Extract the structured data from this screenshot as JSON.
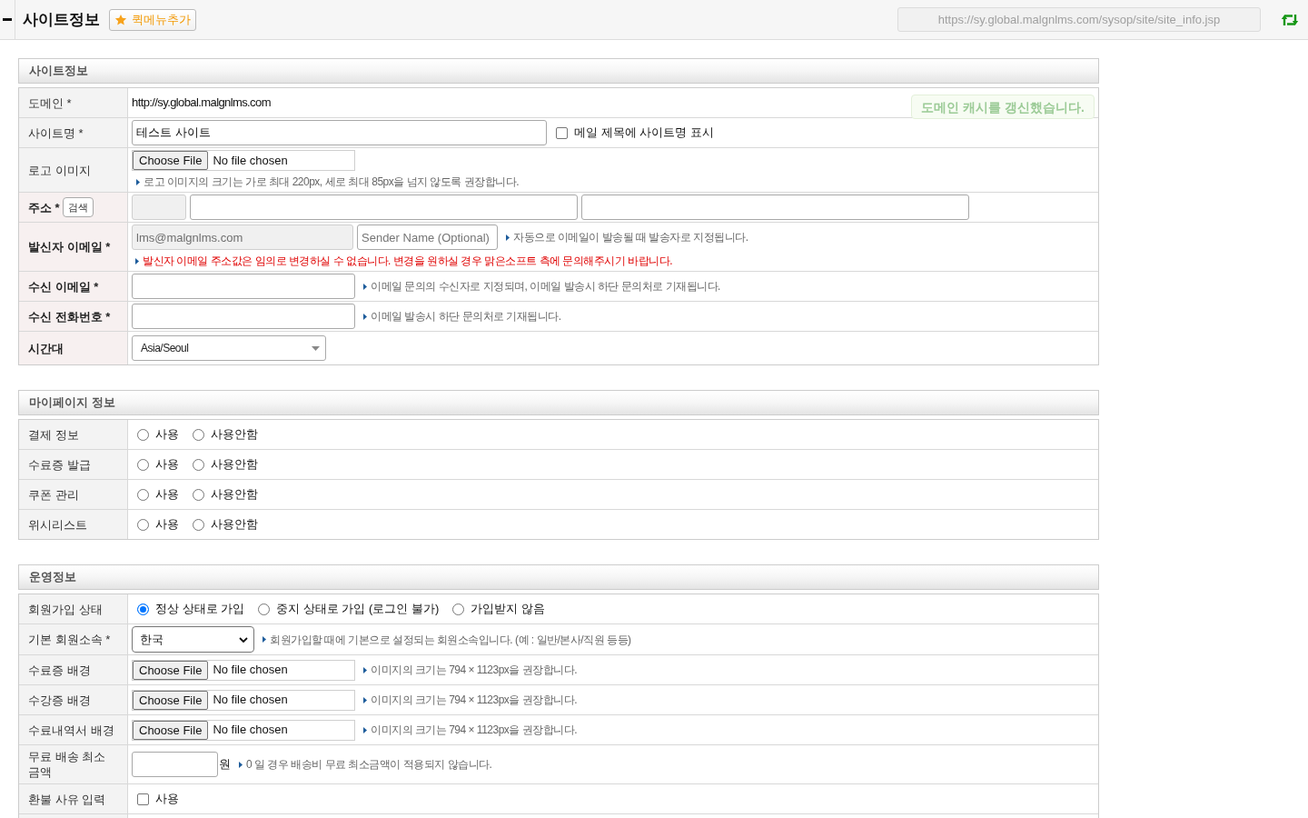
{
  "header": {
    "title": "사이트정보",
    "quick_menu_button": "퀵메뉴추가",
    "url": "https://sy.global.malgnlms.com/sysop/site/site_info.jsp"
  },
  "toast": "도메인 캐시를 갱신했습니다.",
  "sections": [
    {
      "title": "사이트정보",
      "rows": [
        {
          "label": "도메인 *",
          "emphasized": false,
          "lines": [
            [
              {
                "kind": "text",
                "text": "http://sy.global.malgnlms.com"
              }
            ]
          ]
        },
        {
          "label": "사이트명 *",
          "emphasized": false,
          "lines": [
            [
              {
                "kind": "input",
                "value": "테스트 사이트",
                "disabled": false
              },
              {
                "kind": "checkbox",
                "label": "메일 제목에 사이트명 표시",
                "checked": false
              }
            ]
          ]
        },
        {
          "label": "로고 이미지",
          "emphasized": false,
          "lines": [
            [
              {
                "kind": "file",
                "button": "Choose File",
                "status": "No file chosen"
              }
            ],
            [
              {
                "kind": "hint",
                "text": "로고 이미지의 크기는 가로 최대 220px, 세로 최대 85px을 넘지 않도록 권장합니다."
              }
            ]
          ]
        },
        {
          "label": "주소 *",
          "emphasized": true,
          "label_button": "검색",
          "lines": [
            [
              {
                "kind": "input",
                "disabled": true
              },
              {
                "kind": "input",
                "disabled": false
              },
              {
                "kind": "input",
                "disabled": false
              }
            ]
          ]
        },
        {
          "label": "발신자 이메일 *",
          "emphasized": true,
          "lines": [
            [
              {
                "kind": "input",
                "value": "lms@malgnlms.com",
                "disabled": true
              },
              {
                "kind": "input",
                "placeholder": "Sender Name (Optional)",
                "disabled": false
              },
              {
                "kind": "hint",
                "text": "자동으로 이메일이 발송될 때 발송자로 지정됩니다."
              }
            ],
            [
              {
                "kind": "warning",
                "text": "발신자 이메일 주소값은 임의로 변경하실 수 없습니다. 변경을 원하실 경우 맑은소프트 측에 문의해주시기 바랍니다."
              }
            ]
          ]
        },
        {
          "label": "수신 이메일 *",
          "emphasized": true,
          "lines": [
            [
              {
                "kind": "input",
                "disabled": false
              },
              {
                "kind": "hint",
                "text": "이메일 문의의 수신자로 지정되며, 이메일 발송시 하단 문의처로 기재됩니다."
              }
            ]
          ]
        },
        {
          "label": "수신 전화번호 *",
          "emphasized": true,
          "lines": [
            [
              {
                "kind": "input",
                "disabled": false
              },
              {
                "kind": "hint",
                "text": "이메일 발송시 하단 문의처로 기재됩니다."
              }
            ]
          ]
        },
        {
          "label": "시간대",
          "emphasized": true,
          "lines": [
            [
              {
                "kind": "combo",
                "value": "Asia/Seoul"
              }
            ]
          ]
        }
      ]
    },
    {
      "title": "마이페이지 정보",
      "rows": [
        {
          "label": "결제 정보",
          "emphasized": false,
          "lines": [
            [
              {
                "kind": "radio",
                "label": "사용",
                "selected": false
              },
              {
                "kind": "radio",
                "label": "사용안함",
                "selected": false
              }
            ]
          ]
        },
        {
          "label": "수료증 발급",
          "emphasized": false,
          "lines": [
            [
              {
                "kind": "radio",
                "label": "사용",
                "selected": false
              },
              {
                "kind": "radio",
                "label": "사용안함",
                "selected": false
              }
            ]
          ]
        },
        {
          "label": "쿠폰 관리",
          "emphasized": false,
          "lines": [
            [
              {
                "kind": "radio",
                "label": "사용",
                "selected": false
              },
              {
                "kind": "radio",
                "label": "사용안함",
                "selected": false
              }
            ]
          ]
        },
        {
          "label": "위시리스트",
          "emphasized": false,
          "lines": [
            [
              {
                "kind": "radio",
                "label": "사용",
                "selected": false
              },
              {
                "kind": "radio",
                "label": "사용안함",
                "selected": false
              }
            ]
          ]
        }
      ]
    },
    {
      "title": "운영정보",
      "rows": [
        {
          "label": "회원가입 상태",
          "emphasized": false,
          "lines": [
            [
              {
                "kind": "radio",
                "label": "정상 상태로 가입",
                "selected": true
              },
              {
                "kind": "radio",
                "label": "중지 상태로 가입 (로그인 불가)",
                "selected": false
              },
              {
                "kind": "radio",
                "label": "가입받지 않음",
                "selected": false
              }
            ]
          ]
        },
        {
          "label": "기본 회원소속 *",
          "emphasized": false,
          "lines": [
            [
              {
                "kind": "select",
                "value": "한국"
              },
              {
                "kind": "hint",
                "text": "회원가입할 때에 기본으로 설정되는 회원소속입니다. (예 : 일반/본사/직원 등등)"
              }
            ]
          ]
        },
        {
          "label": "수료증 배경",
          "emphasized": false,
          "lines": [
            [
              {
                "kind": "file",
                "button": "Choose File",
                "status": "No file chosen"
              },
              {
                "kind": "hint",
                "text": "이미지의 크기는 794 × 1123px을 권장합니다."
              }
            ]
          ]
        },
        {
          "label": "수강증 배경",
          "emphasized": false,
          "lines": [
            [
              {
                "kind": "file",
                "button": "Choose File",
                "status": "No file chosen"
              },
              {
                "kind": "hint",
                "text": "이미지의 크기는 794 × 1123px을 권장합니다."
              }
            ]
          ]
        },
        {
          "label": "수료내역서 배경",
          "emphasized": false,
          "lines": [
            [
              {
                "kind": "file",
                "button": "Choose File",
                "status": "No file chosen"
              },
              {
                "kind": "hint",
                "text": "이미지의 크기는 794 × 1123px을 권장합니다."
              }
            ]
          ]
        },
        {
          "label": "무료 배송 최소 금액",
          "emphasized": false,
          "lines": [
            [
              {
                "kind": "input",
                "disabled": false
              },
              {
                "kind": "unit",
                "text": "원"
              },
              {
                "kind": "hint",
                "text": "0 일 경우 배송비 무료 최소금액이 적용되지 않습니다."
              }
            ]
          ]
        },
        {
          "label": "환불 사유 입력",
          "emphasized": false,
          "lines": [
            [
              {
                "kind": "checkbox",
                "label": "사용",
                "checked": false
              }
            ]
          ]
        }
      ]
    }
  ]
}
